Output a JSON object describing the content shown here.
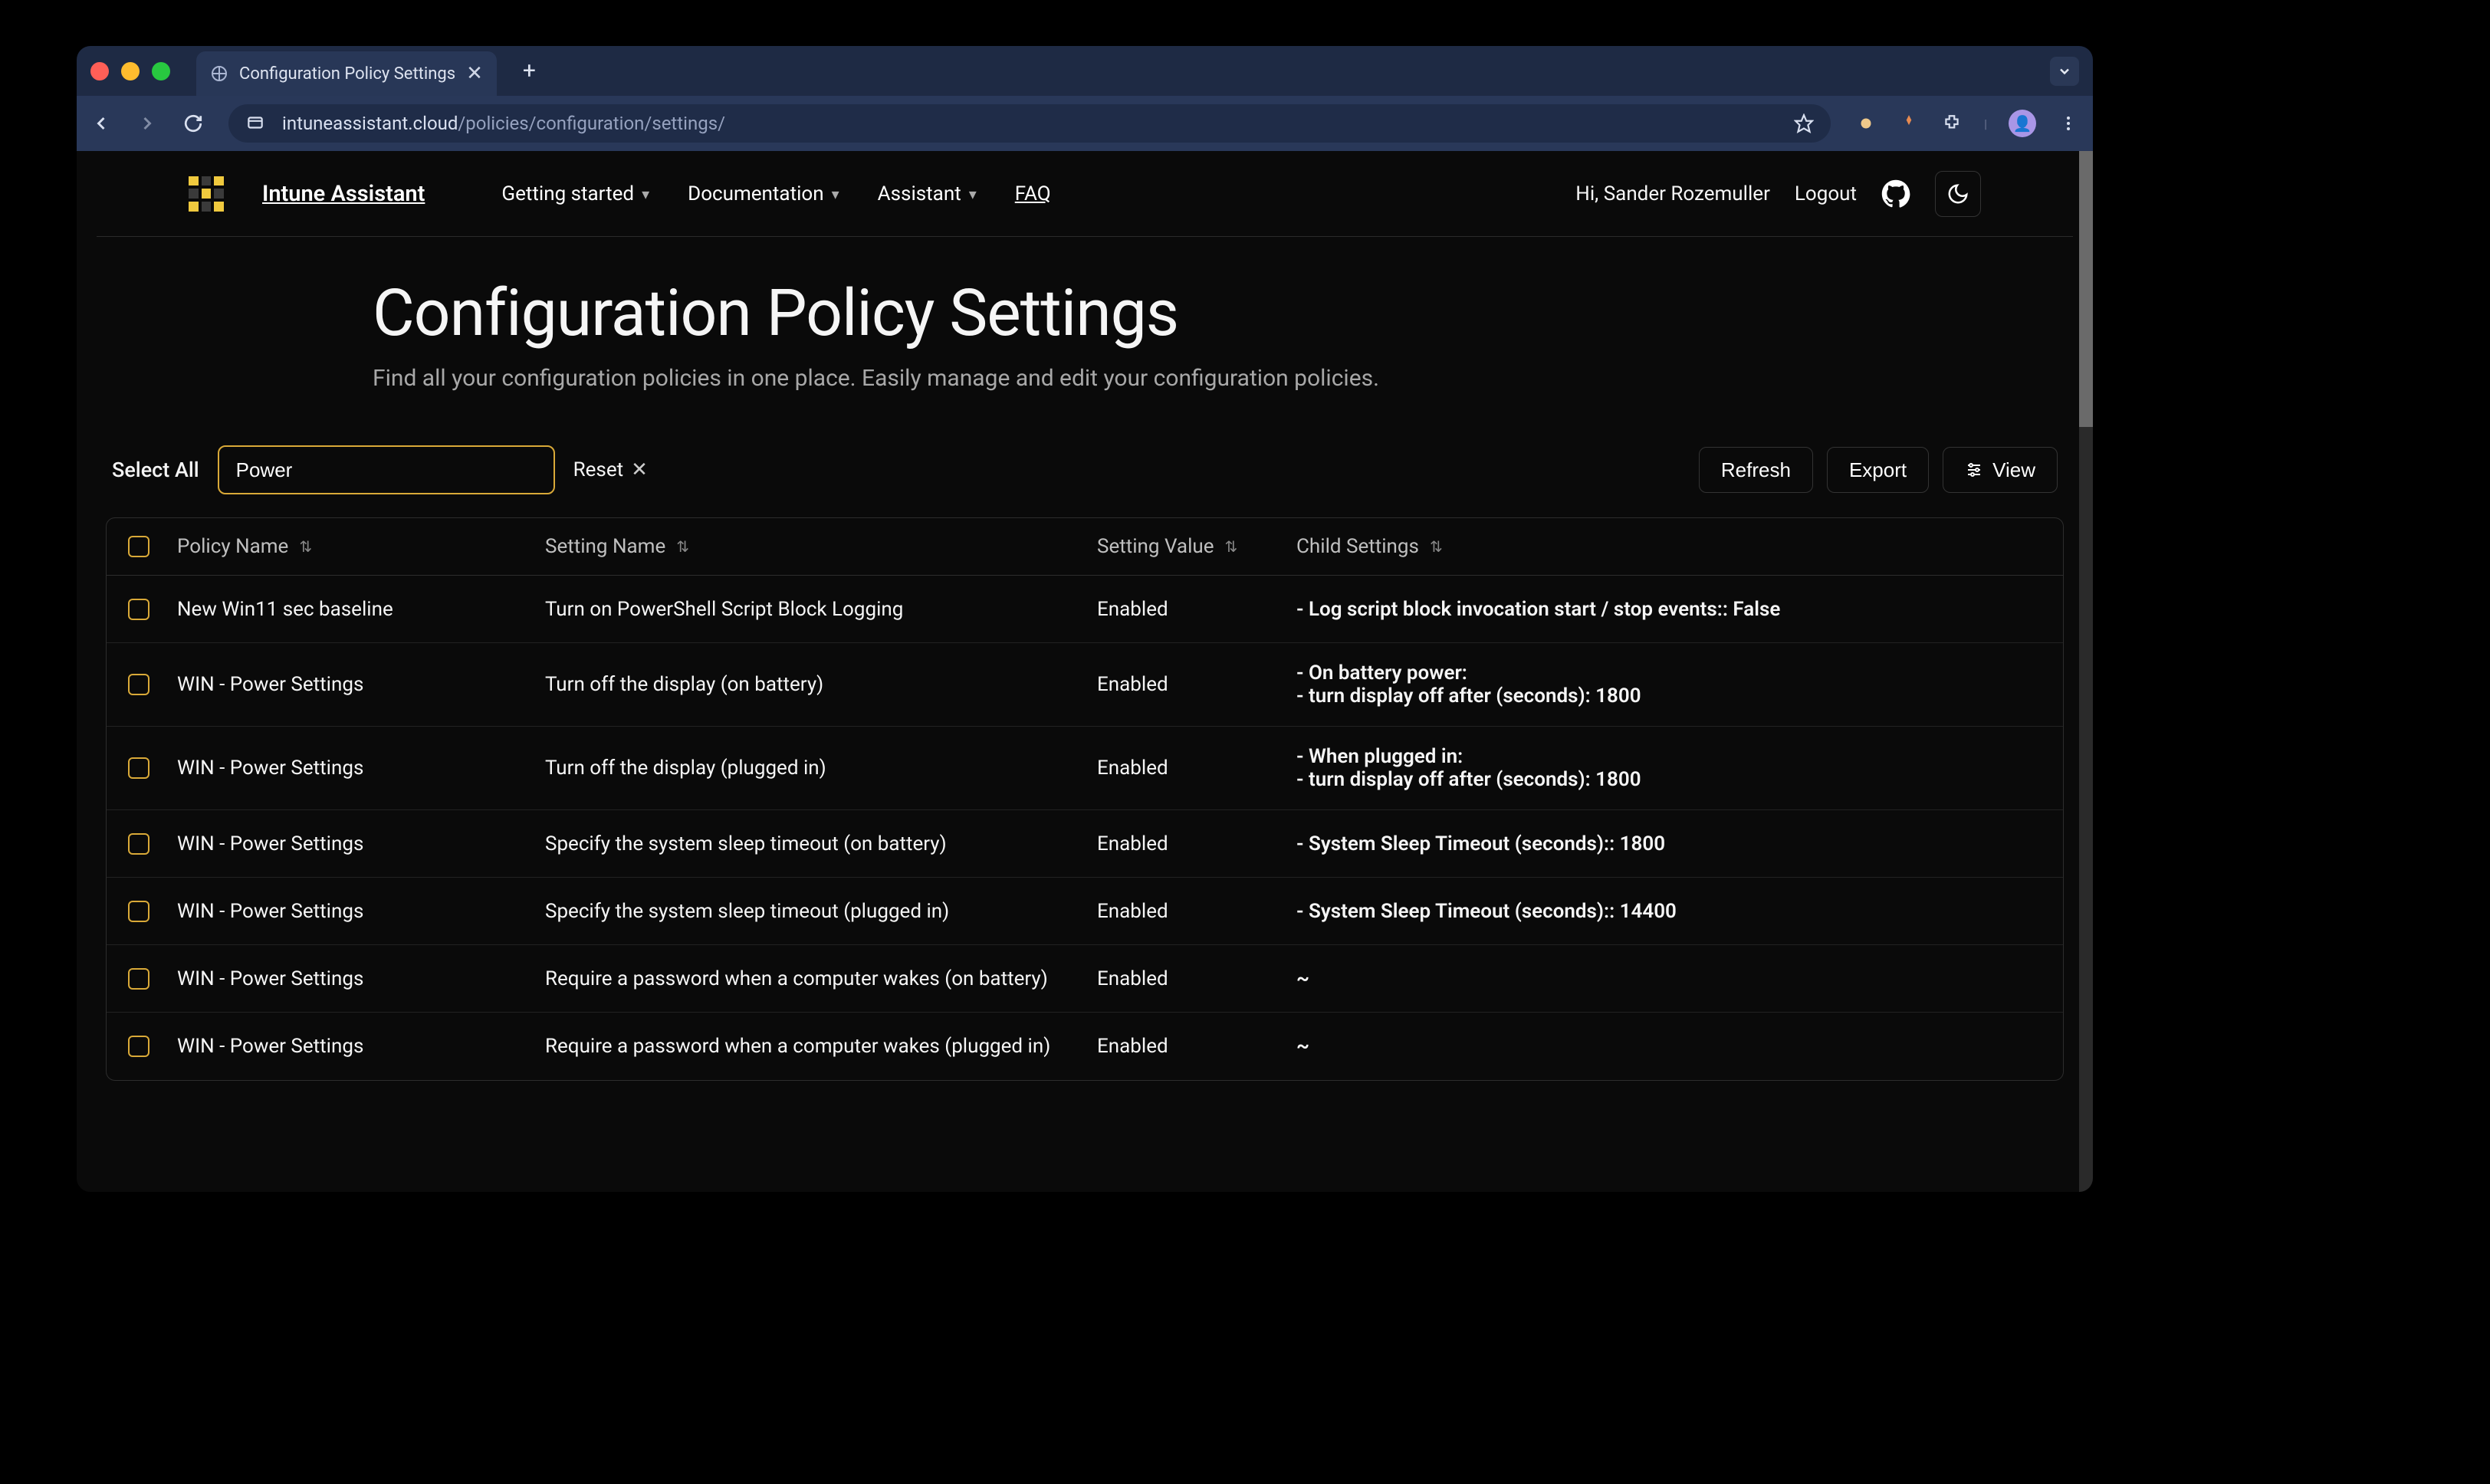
{
  "browser": {
    "tab_title": "Configuration Policy Settings",
    "url_host": "intuneassistant.cloud",
    "url_path": "/policies/configuration/settings/"
  },
  "nav": {
    "brand": "Intune Assistant",
    "items": [
      {
        "label": "Getting started",
        "hasDropdown": true
      },
      {
        "label": "Documentation",
        "hasDropdown": true
      },
      {
        "label": "Assistant",
        "hasDropdown": true
      },
      {
        "label": "FAQ",
        "hasDropdown": false,
        "underline": true
      }
    ],
    "greeting": "Hi, Sander Rozemuller",
    "logout": "Logout"
  },
  "page": {
    "title": "Configuration Policy Settings",
    "subtitle": "Find all your configuration policies in one place. Easily manage and edit your configuration policies."
  },
  "toolbar": {
    "select_all": "Select All",
    "filter_value": "Power",
    "reset": "Reset",
    "refresh": "Refresh",
    "export": "Export",
    "view": "View"
  },
  "table": {
    "headers": {
      "policy": "Policy Name",
      "setting": "Setting Name",
      "value": "Setting Value",
      "child": "Child Settings"
    },
    "rows": [
      {
        "policy": "New Win11 sec baseline",
        "setting": "Turn on PowerShell Script Block Logging",
        "value": "Enabled",
        "child": "- Log script block invocation start / stop events:: False"
      },
      {
        "policy": "WIN - Power Settings",
        "setting": "Turn off the display (on battery)",
        "value": "Enabled",
        "child": "- On battery power:\n- turn display off after (seconds): 1800"
      },
      {
        "policy": "WIN - Power Settings",
        "setting": "Turn off the display (plugged in)",
        "value": "Enabled",
        "child": "- When plugged in:\n- turn display off after (seconds): 1800"
      },
      {
        "policy": "WIN - Power Settings",
        "setting": "Specify the system sleep timeout (on battery)",
        "value": "Enabled",
        "child": "- System Sleep Timeout (seconds):: 1800"
      },
      {
        "policy": "WIN - Power Settings",
        "setting": "Specify the system sleep timeout (plugged in)",
        "value": "Enabled",
        "child": "- System Sleep Timeout (seconds):: 14400"
      },
      {
        "policy": "WIN - Power Settings",
        "setting": "Require a password when a computer wakes (on battery)",
        "value": "Enabled",
        "child": "~"
      },
      {
        "policy": "WIN - Power Settings",
        "setting": "Require a password when a computer wakes (plugged in)",
        "value": "Enabled",
        "child": "~"
      }
    ]
  }
}
